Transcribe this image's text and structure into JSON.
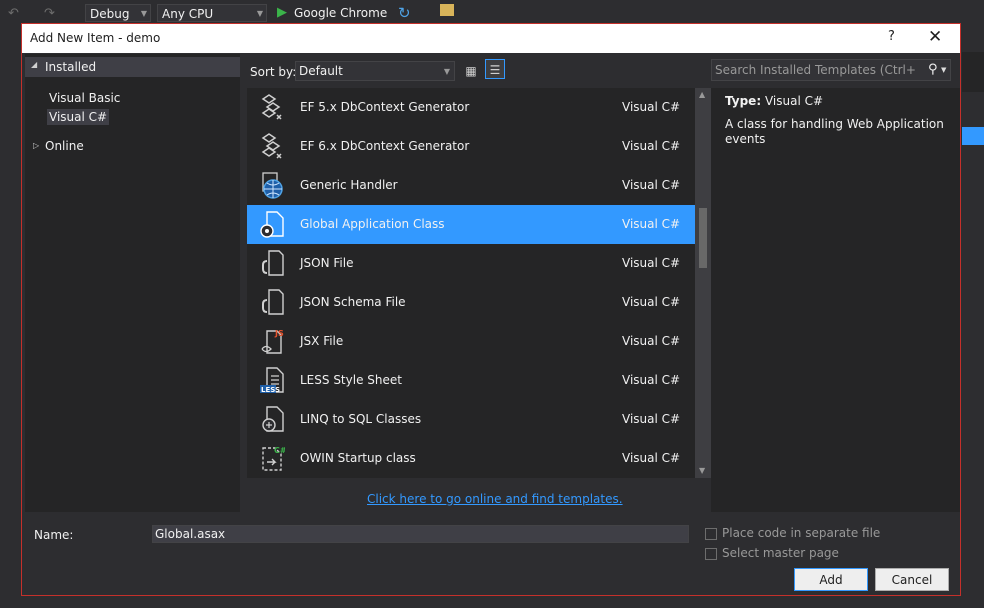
{
  "toolbar": {
    "config": "Debug",
    "platform": "Any CPU",
    "browser": "Google Chrome"
  },
  "dialog": {
    "title": "Add New Item - demo",
    "help": "?",
    "close": "✕"
  },
  "tree": {
    "installed": "Installed",
    "visual_basic": "Visual Basic",
    "visual_csharp": "Visual C#",
    "online": "Online"
  },
  "sort": {
    "label": "Sort by:",
    "value": "Default"
  },
  "search": {
    "placeholder": "Search Installed Templates (Ctrl+E)"
  },
  "templates": [
    {
      "name": "EF 5.x DbContext Generator",
      "lang": "Visual C#",
      "icon": "ef-generator-icon"
    },
    {
      "name": "EF 6.x DbContext Generator",
      "lang": "Visual C#",
      "icon": "ef-generator-icon"
    },
    {
      "name": "Generic Handler",
      "lang": "Visual C#",
      "icon": "globe-icon"
    },
    {
      "name": "Global Application Class",
      "lang": "Visual C#",
      "icon": "global-app-class-icon"
    },
    {
      "name": "JSON File",
      "lang": "Visual C#",
      "icon": "json-file-icon"
    },
    {
      "name": "JSON Schema File",
      "lang": "Visual C#",
      "icon": "json-schema-icon"
    },
    {
      "name": "JSX File",
      "lang": "Visual C#",
      "icon": "jsx-file-icon"
    },
    {
      "name": "LESS Style Sheet",
      "lang": "Visual C#",
      "icon": "less-file-icon"
    },
    {
      "name": "LINQ to SQL Classes",
      "lang": "Visual C#",
      "icon": "linq-sql-icon"
    },
    {
      "name": "OWIN Startup class",
      "lang": "Visual C#",
      "icon": "owin-startup-icon"
    }
  ],
  "details": {
    "type_label": "Type:",
    "type_value": "Visual C#",
    "description": "A class for handling Web Application events"
  },
  "online_link": "Click here to go online and find templates.",
  "name_field": {
    "label": "Name:",
    "value": "Global.asax"
  },
  "options": {
    "separate_file": "Place code in separate file",
    "master_page": "Select master page"
  },
  "buttons": {
    "add": "Add",
    "cancel": "Cancel"
  },
  "colors": {
    "accent": "#3399ff",
    "dialog_border": "#c4302b",
    "background": "#2d2d30"
  }
}
